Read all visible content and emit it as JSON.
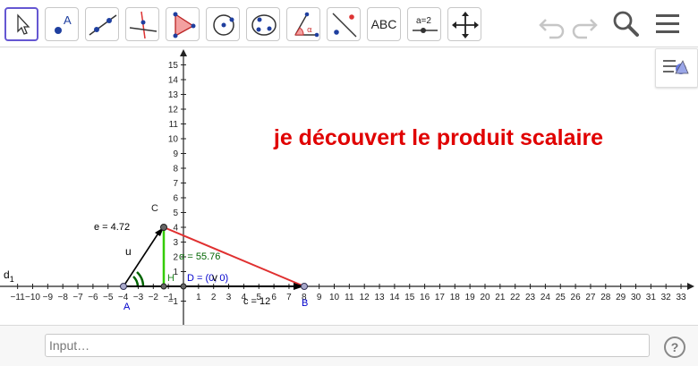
{
  "toolbar": {
    "text_tool_label": "ABC",
    "slider_tool_label": "a=2",
    "point_tool_label": "A",
    "tools": [
      "move-tool",
      "point-tool",
      "line-tool",
      "perpendicular-line-tool",
      "polygon-tool",
      "circle-tool",
      "conic-tool",
      "angle-tool",
      "reflect-tool",
      "text-tool",
      "slider-tool",
      "move-graphics-view-tool"
    ],
    "actions": [
      "undo",
      "redo",
      "search",
      "menu"
    ]
  },
  "graphics": {
    "title": "je découvert le produit scalaire",
    "title_color": "#e00000",
    "x_ticks": [
      "−11",
      "−10",
      "−9",
      "−8",
      "−7",
      "−6",
      "−5",
      "−4",
      "−3",
      "−2",
      "−1",
      "1",
      "2",
      "3",
      "4",
      "5",
      "6",
      "7",
      "8",
      "9",
      "10",
      "11",
      "12",
      "13",
      "14",
      "15",
      "16",
      "17",
      "18",
      "19",
      "20",
      "21",
      "22",
      "23",
      "24",
      "25",
      "26",
      "27",
      "28",
      "29",
      "30",
      "31",
      "32",
      "33"
    ],
    "y_ticks": [
      "15",
      "14",
      "13",
      "12",
      "11",
      "10",
      "9",
      "8",
      "7",
      "6",
      "5",
      "4",
      "3",
      "2",
      "1",
      "−1"
    ],
    "points": {
      "A": "A",
      "B": "B",
      "C": "C",
      "H": "H",
      "D": "D = (0, 0)"
    },
    "labels": {
      "e": "e = 4.72",
      "c": "c = 12",
      "alpha": "α = 55.76",
      "u": "u",
      "v": "v",
      "d1_main": "d",
      "d1_sub": "1"
    },
    "colors": {
      "segment_a": "#e03030",
      "height": "#33cc00",
      "angle": "#006400",
      "vector": "#000000",
      "point_label": "#0000cc"
    }
  },
  "input_bar": {
    "placeholder": "Input…",
    "help_label": "?"
  }
}
